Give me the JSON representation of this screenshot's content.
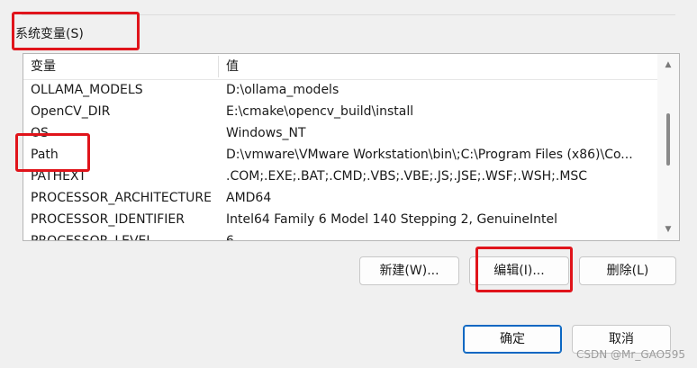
{
  "section": {
    "label": "系统变量(S)"
  },
  "table": {
    "columns": {
      "name": "变量",
      "value": "值"
    },
    "rows": [
      {
        "name": "OLLAMA_MODELS",
        "value": "D:\\ollama_models"
      },
      {
        "name": "OpenCV_DIR",
        "value": "E:\\cmake\\opencv_build\\install"
      },
      {
        "name": "OS",
        "value": "Windows_NT"
      },
      {
        "name": "Path",
        "value": "D:\\vmware\\VMware Workstation\\bin\\;C:\\Program Files (x86)\\Co..."
      },
      {
        "name": "PATHEXT",
        "value": ".COM;.EXE;.BAT;.CMD;.VBS;.VBE;.JS;.JSE;.WSF;.WSH;.MSC"
      },
      {
        "name": "PROCESSOR_ARCHITECTURE",
        "value": "AMD64"
      },
      {
        "name": "PROCESSOR_IDENTIFIER",
        "value": "Intel64 Family 6 Model 140 Stepping 2, GenuineIntel"
      },
      {
        "name": "PROCESSOR_LEVEL",
        "value": "6"
      }
    ]
  },
  "buttons": {
    "new": "新建(W)...",
    "edit": "编辑(I)...",
    "delete": "删除(L)",
    "ok": "确定",
    "cancel": "取消"
  },
  "watermark": "CSDN @Mr_GAO595",
  "colors": {
    "highlight_box": "#e0141b",
    "default_button_border": "#0b67c2"
  },
  "icons": {
    "scroll_up": "triangle-up",
    "scroll_down": "triangle-down"
  }
}
